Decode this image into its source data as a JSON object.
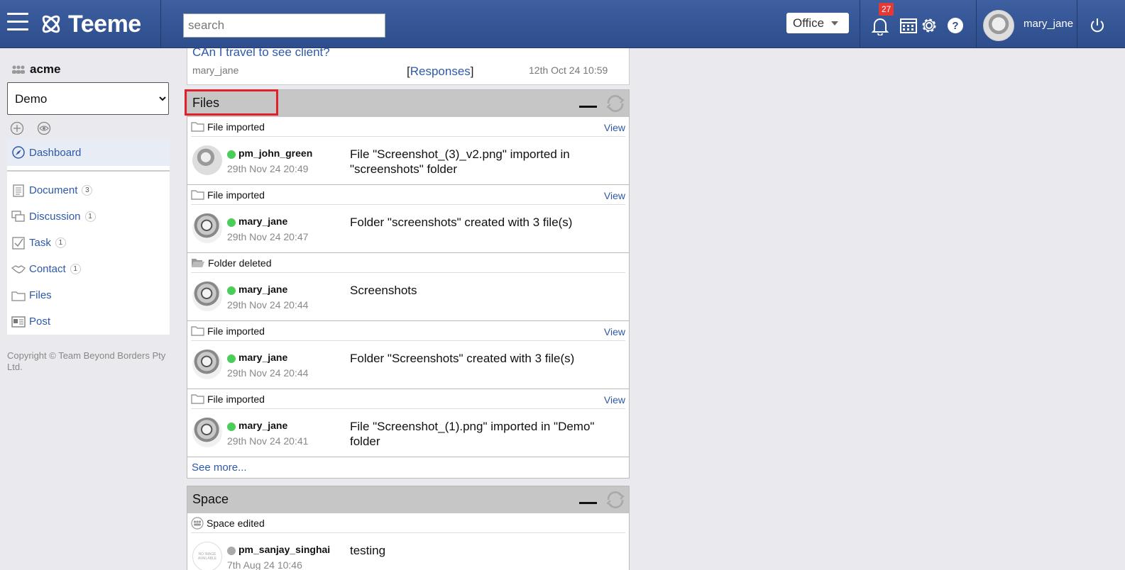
{
  "app": {
    "logo_text": "Teeme",
    "search_placeholder": "search",
    "workspace_select": "Office",
    "notification_count": "27",
    "username": "mary_jane"
  },
  "sidebar": {
    "org_name": "acme",
    "space_selected": "Demo",
    "items": [
      {
        "label": "Dashboard",
        "count": ""
      },
      {
        "label": "Document",
        "count": "3"
      },
      {
        "label": "Discussion",
        "count": "1"
      },
      {
        "label": "Task",
        "count": "1"
      },
      {
        "label": "Contact",
        "count": "1"
      },
      {
        "label": "Files",
        "count": ""
      },
      {
        "label": "Post",
        "count": ""
      }
    ],
    "copyright": "Copyright © Team Beyond Borders Pty Ltd."
  },
  "top_post": {
    "title": "CAn I travel to see client?",
    "author": "mary_jane",
    "responses_link": "Responses",
    "bracket_open": "[",
    "bracket_close": "]",
    "date": "12th Oct 24 10:59"
  },
  "files_widget": {
    "title": "Files",
    "entries": [
      {
        "type": "File imported",
        "view": "View",
        "user": "pm_john_green",
        "date": "29th Nov 24 20:49",
        "text": "File \"Screenshot_(3)_v2.png\" imported in \"screenshots\" folder"
      },
      {
        "type": "File imported",
        "view": "View",
        "user": "mary_jane",
        "date": "29th Nov 24 20:47",
        "text": "Folder \"screenshots\" created with 3 file(s)"
      },
      {
        "type": "Folder deleted",
        "view": "",
        "user": "mary_jane",
        "date": "29th Nov 24 20:44",
        "text": "Screenshots"
      },
      {
        "type": "File imported",
        "view": "View",
        "user": "mary_jane",
        "date": "29th Nov 24 20:44",
        "text": "Folder \"Screenshots\" created with 3 file(s)"
      },
      {
        "type": "File imported",
        "view": "View",
        "user": "mary_jane",
        "date": "29th Nov 24 20:41",
        "text": "File \"Screenshot_(1).png\" imported in \"Demo\" folder"
      }
    ],
    "see_more": "See more..."
  },
  "space_widget": {
    "title": "Space",
    "entries": [
      {
        "type": "Space edited",
        "user": "pm_sanjay_singhai",
        "date": "7th Aug 24 10:46",
        "text": "testing",
        "avatar_text": "NO IMAGE AVAILABLE"
      }
    ]
  }
}
